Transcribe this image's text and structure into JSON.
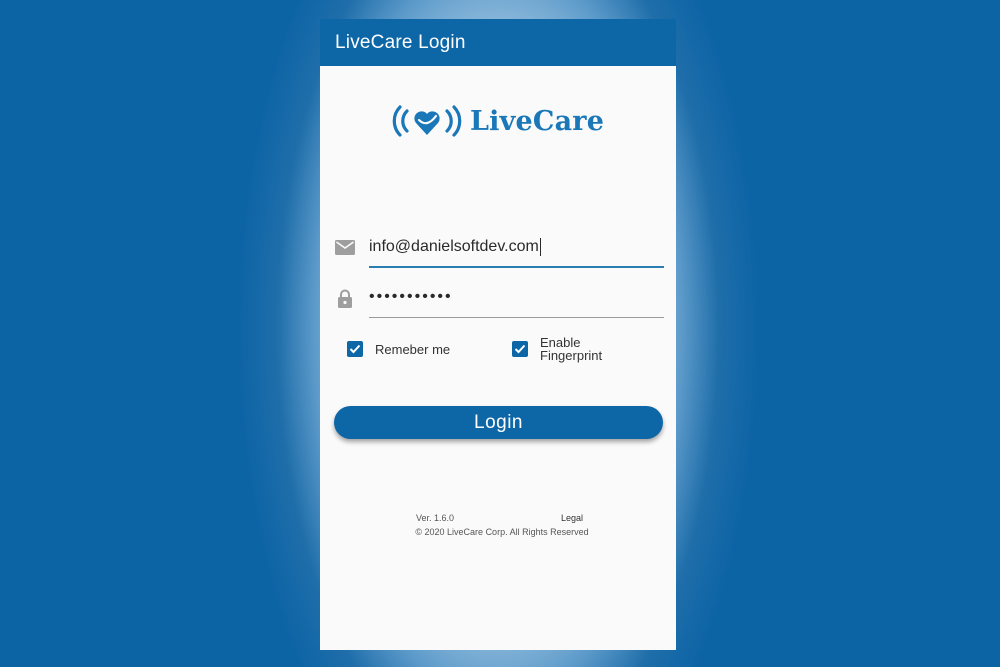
{
  "app": {
    "title": "LiveCare Login",
    "brand": "LiveCare"
  },
  "colors": {
    "primary": "#0d66a6",
    "logo": "#1a77b8"
  },
  "form": {
    "email": {
      "icon": "mail-icon",
      "value": "info@danielsoftdev.com"
    },
    "password": {
      "icon": "lock-icon",
      "value": "•••••••••••"
    },
    "remember": {
      "label": "Remeber me",
      "checked": true
    },
    "fingerprint": {
      "label_line1": "Enable",
      "label_line2": "Fingerprint",
      "checked": true
    },
    "login_label": "Login"
  },
  "footer": {
    "version": "Ver. 1.6.0",
    "legal": "Legal",
    "copyright": "© 2020 LiveCare Corp. All Rights Reserved"
  }
}
